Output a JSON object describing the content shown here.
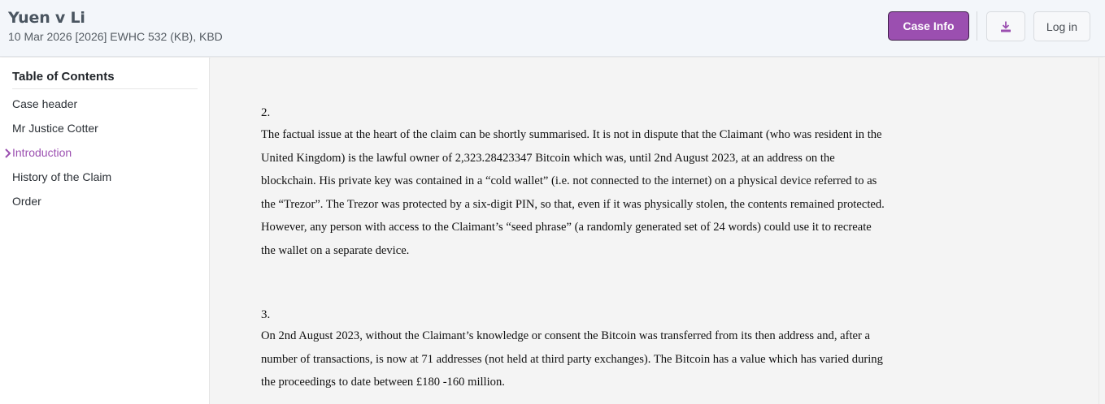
{
  "header": {
    "title": "Yuen v Li",
    "citation": "10 Mar 2026 [2026] EWHC 532 (KB), KBD",
    "case_info_label": "Case Info",
    "download_icon": "download-icon",
    "login_label": "Log in",
    "accent_color": "#9b4fb0"
  },
  "sidebar": {
    "title": "Table of Contents",
    "items": [
      {
        "label": "Case header"
      },
      {
        "label": "Mr Justice Cotter"
      },
      {
        "label": "Introduction",
        "active": true
      },
      {
        "label": "History of the Claim"
      },
      {
        "label": "Order"
      }
    ]
  },
  "main": {
    "paragraphs": [
      {
        "number": "2.",
        "text": "The factual issue at the heart of the claim can be shortly summarised. It is not in dispute that the Claimant (who was resident in the United Kingdom) is the lawful owner of 2,323.28423347 Bitcoin which was, until 2nd August 2023, at an address on the blockchain. His private key was contained in a “cold wallet” (i.e. not connected to the internet) on a physical device referred to as the “Trezor”. The Trezor was protected by a six-digit PIN, so that, even if it was physically stolen, the contents remained protected. However, any person with access to the Claimant’s “seed phrase” (a randomly generated set of 24 words) could use it to recreate the wallet on a separate device."
      },
      {
        "number": "3.",
        "text": "On 2nd August 2023, without the Claimant’s knowledge or consent the Bitcoin was transferred from its then address and, after a number of transactions, is now at 71 addresses (not held at third party exchanges). The Bitcoin has a value which has varied during the proceedings to date between £180 -160 million."
      }
    ]
  }
}
